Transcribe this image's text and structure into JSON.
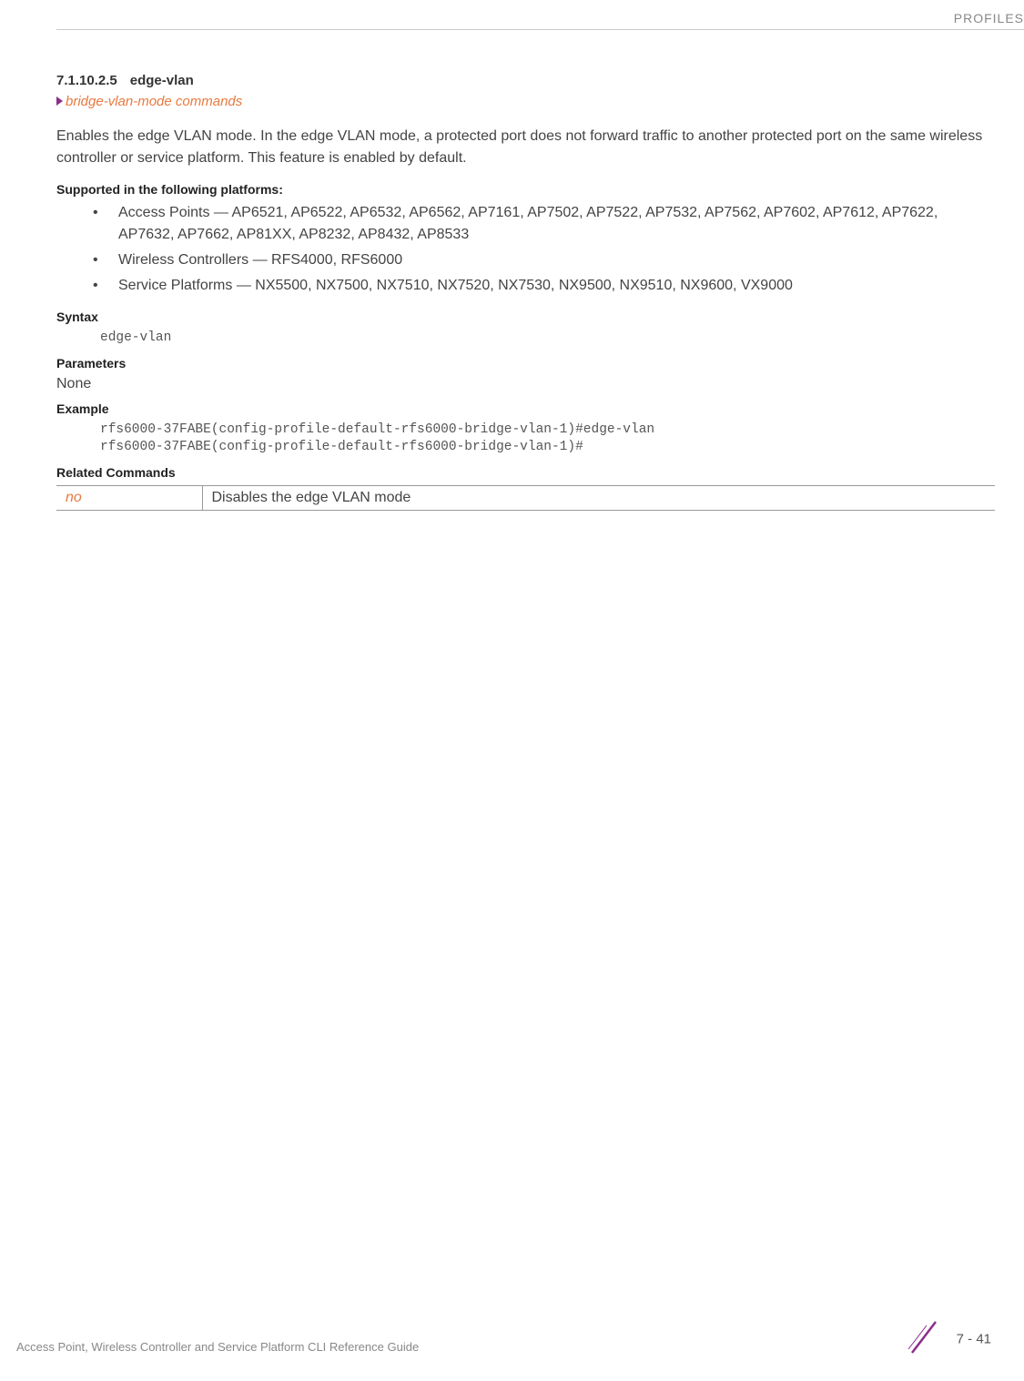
{
  "header": {
    "category": "PROFILES"
  },
  "section": {
    "number": "7.1.10.2.5",
    "title": "edge-vlan",
    "breadcrumb": "bridge-vlan-mode commands",
    "description": "Enables the edge VLAN mode. In the edge VLAN mode, a protected port does not forward traffic to another protected port on the same wireless controller or service platform. This feature is enabled by default."
  },
  "platforms": {
    "heading": "Supported in the following platforms:",
    "items": [
      "Access Points — AP6521, AP6522, AP6532, AP6562, AP7161, AP7502, AP7522, AP7532, AP7562, AP7602, AP7612, AP7622, AP7632, AP7662, AP81XX, AP8232, AP8432, AP8533",
      "Wireless Controllers — RFS4000, RFS6000",
      "Service Platforms — NX5500, NX7500, NX7510, NX7520, NX7530, NX9500, NX9510, NX9600, VX9000"
    ]
  },
  "syntax": {
    "heading": "Syntax",
    "code": "edge-vlan"
  },
  "parameters": {
    "heading": "Parameters",
    "text": "None"
  },
  "example": {
    "heading": "Example",
    "code": "rfs6000-37FABE(config-profile-default-rfs6000-bridge-vlan-1)#edge-vlan\nrfs6000-37FABE(config-profile-default-rfs6000-bridge-vlan-1)#"
  },
  "related": {
    "heading": "Related Commands",
    "rows": [
      {
        "command": "no",
        "description": "Disables the edge VLAN mode"
      }
    ]
  },
  "footer": {
    "text": "Access Point, Wireless Controller and Service Platform CLI Reference Guide",
    "page": "7 - 41"
  }
}
